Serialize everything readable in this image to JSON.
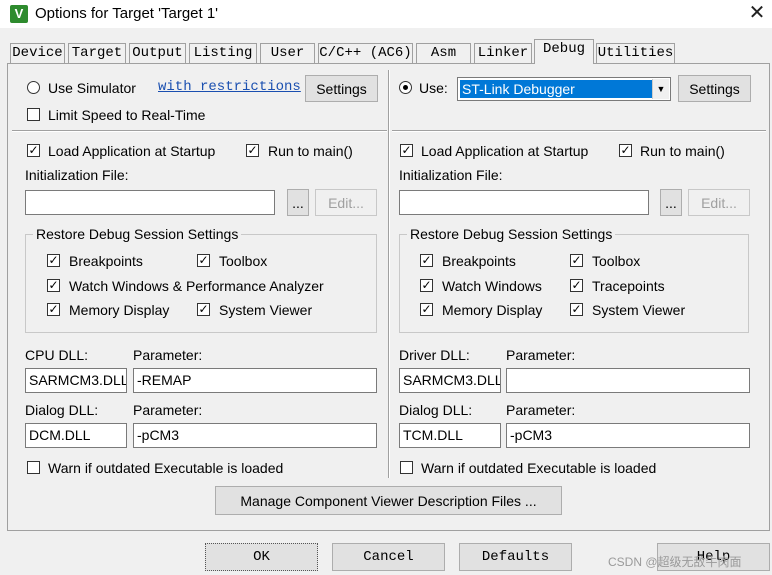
{
  "window": {
    "title": "Options for Target 'Target 1'"
  },
  "tabs": [
    {
      "label": "Device"
    },
    {
      "label": "Target"
    },
    {
      "label": "Output"
    },
    {
      "label": "Listing"
    },
    {
      "label": "User"
    },
    {
      "label": "C/C++ (AC6)"
    },
    {
      "label": "Asm"
    },
    {
      "label": "Linker"
    },
    {
      "label": "Debug"
    },
    {
      "label": "Utilities"
    }
  ],
  "left": {
    "use_simulator": "Use Simulator",
    "with_restrictions": "with restrictions",
    "settings": "Settings",
    "limit_speed": "Limit Speed to Real-Time",
    "load_app": "Load Application at Startup",
    "run_to_main": "Run to main()",
    "init_file": "Initialization File:",
    "browse": "...",
    "edit": "Edit...",
    "restore_title": "Restore Debug Session Settings",
    "breakpoints": "Breakpoints",
    "toolbox": "Toolbox",
    "watch_windows": "Watch Windows & Performance Analyzer",
    "memory_display": "Memory Display",
    "system_viewer": "System Viewer",
    "cpu_dll_label": "CPU DLL:",
    "parameter_label": "Parameter:",
    "cpu_dll": "SARMCM3.DLL",
    "cpu_param": "-REMAP",
    "dialog_dll_label": "Dialog DLL:",
    "dialog_dll": "DCM.DLL",
    "dialog_param": "-pCM3",
    "warn": "Warn if outdated Executable is loaded"
  },
  "right": {
    "use": "Use:",
    "debugger": "ST-Link Debugger",
    "settings": "Settings",
    "load_app": "Load Application at Startup",
    "run_to_main": "Run to main()",
    "init_file": "Initialization File:",
    "browse": "...",
    "edit": "Edit...",
    "restore_title": "Restore Debug Session Settings",
    "breakpoints": "Breakpoints",
    "toolbox": "Toolbox",
    "watch_windows": "Watch Windows",
    "tracepoints": "Tracepoints",
    "memory_display": "Memory Display",
    "system_viewer": "System Viewer",
    "driver_dll_label": "Driver DLL:",
    "parameter_label": "Parameter:",
    "driver_dll": "SARMCM3.DLL",
    "driver_param": "",
    "dialog_dll_label": "Dialog DLL:",
    "dialog_dll": "TCM.DLL",
    "dialog_param": "-pCM3",
    "warn": "Warn if outdated Executable is loaded"
  },
  "manage": "Manage Component Viewer Description Files ...",
  "bottom": {
    "ok": "OK",
    "cancel": "Cancel",
    "defaults": "Defaults",
    "help": "Help"
  },
  "watermark": "CSDN @超级无敌牛肉面",
  "check_glyph": "✓",
  "close_glyph": "✕",
  "arrow_glyph": "▼",
  "app_icon_glyph": "V"
}
